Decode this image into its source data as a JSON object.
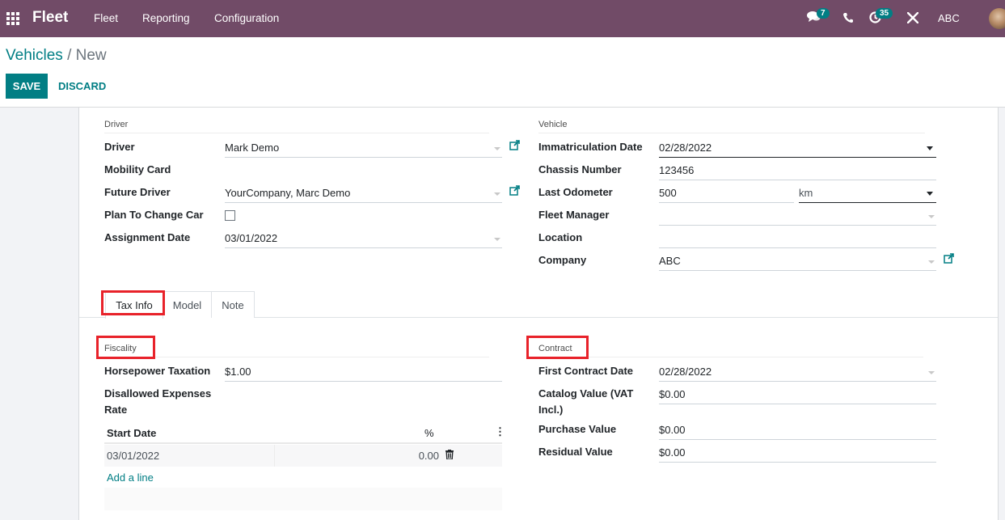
{
  "navbar": {
    "app_name": "Fleet",
    "menu": [
      "Fleet",
      "Reporting",
      "Configuration"
    ],
    "messages_badge": "7",
    "activities_badge": "35",
    "company": "ABC",
    "icons": [
      "apps-grid-icon",
      "chat-icon",
      "phone-icon",
      "clock-icon",
      "tools-icon",
      "user-avatar"
    ]
  },
  "breadcrumb": {
    "parent": "Vehicles",
    "separator": "/",
    "current": "New"
  },
  "buttons": {
    "save": "SAVE",
    "discard": "DISCARD"
  },
  "driver_group": {
    "title": "Driver",
    "fields": [
      {
        "label": "Driver",
        "value": "Mark Demo"
      },
      {
        "label": "Mobility Card",
        "value": ""
      },
      {
        "label": "Future Driver",
        "value": "YourCompany, Marc Demo"
      },
      {
        "label": "Plan To Change Car",
        "checked": false
      },
      {
        "label": "Assignment Date",
        "value": "03/01/2022"
      }
    ]
  },
  "vehicle_group": {
    "title": "Vehicle",
    "fields": [
      {
        "label": "Immatriculation Date",
        "value": "02/28/2022"
      },
      {
        "label": "Chassis Number",
        "value": "123456"
      },
      {
        "label": "Last Odometer",
        "value": "500",
        "unit": "km"
      },
      {
        "label": "Fleet Manager",
        "value": ""
      },
      {
        "label": "Location",
        "value": ""
      },
      {
        "label": "Company",
        "value": "ABC"
      }
    ]
  },
  "tabs": [
    {
      "label": "Tax Info",
      "active": true
    },
    {
      "label": "Model",
      "active": false
    },
    {
      "label": "Note",
      "active": false
    }
  ],
  "fiscality": {
    "title": "Fiscality",
    "horsepower_label": "Horsepower Taxation",
    "horsepower_value": "$1.00",
    "disallowed_label": "Disallowed Expenses Rate",
    "table": {
      "headers": [
        "Start Date",
        "%"
      ],
      "rows": [
        {
          "start_date": "03/01/2022",
          "percent": "0.00"
        }
      ],
      "add_line": "Add a line"
    }
  },
  "contract": {
    "title": "Contract",
    "fields": [
      {
        "label": "First Contract Date",
        "value": "02/28/2022"
      },
      {
        "label": "Catalog Value (VAT Incl.)",
        "value": "$0.00"
      },
      {
        "label": "Purchase Value",
        "value": "$0.00"
      },
      {
        "label": "Residual Value",
        "value": "$0.00"
      }
    ]
  },
  "colors": {
    "brand": "#714B67",
    "accent": "#017E84",
    "highlight": "#e8222a"
  }
}
